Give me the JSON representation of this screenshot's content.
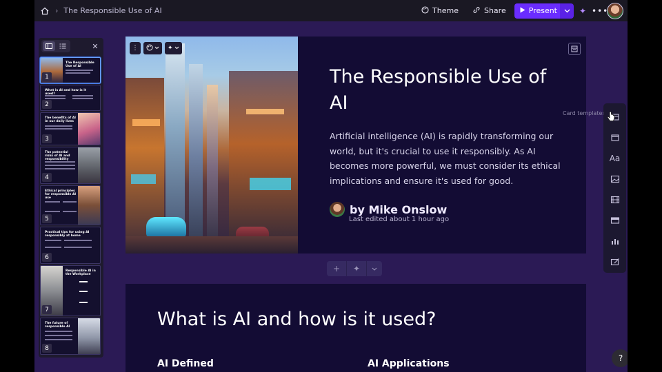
{
  "topbar": {
    "doc_title": "The Responsible Use of AI",
    "theme_label": "Theme",
    "share_label": "Share",
    "present_label": "Present"
  },
  "thumbnails": [
    {
      "num": "1",
      "title": "The Responsible Use of AI"
    },
    {
      "num": "2",
      "title": "What is AI and how is it used?"
    },
    {
      "num": "3",
      "title": "The benefits of AI in our daily lives"
    },
    {
      "num": "4",
      "title": "The potential risks of AI and responsibility"
    },
    {
      "num": "5",
      "title": "Ethical principles for responsible AI use"
    },
    {
      "num": "6",
      "title": "Practical tips for using AI responsibly at home"
    },
    {
      "num": "7",
      "title": "Responsible AI in the Workplace"
    },
    {
      "num": "8",
      "title": "The future of responsible AI"
    }
  ],
  "card1": {
    "title": "The Responsible Use of AI",
    "lead": "Artificial intelligence (AI) is rapidly transforming our world, but it's crucial to use it responsibly. As AI becomes more powerful, we must consider its ethical implications and ensure it's used for good.",
    "author": "by Mike Onslow",
    "meta": "Last edited about 1 hour ago"
  },
  "card2": {
    "title": "What is AI and how is it used?",
    "sub_left": "AI Defined",
    "sub_right": "AI Applications"
  },
  "right_toolbar": {
    "tooltip": "Card templates"
  },
  "help_label": "?",
  "colors": {
    "accent": "#6a2cff",
    "canvas": "#2b1a55",
    "card": "#130c34"
  }
}
